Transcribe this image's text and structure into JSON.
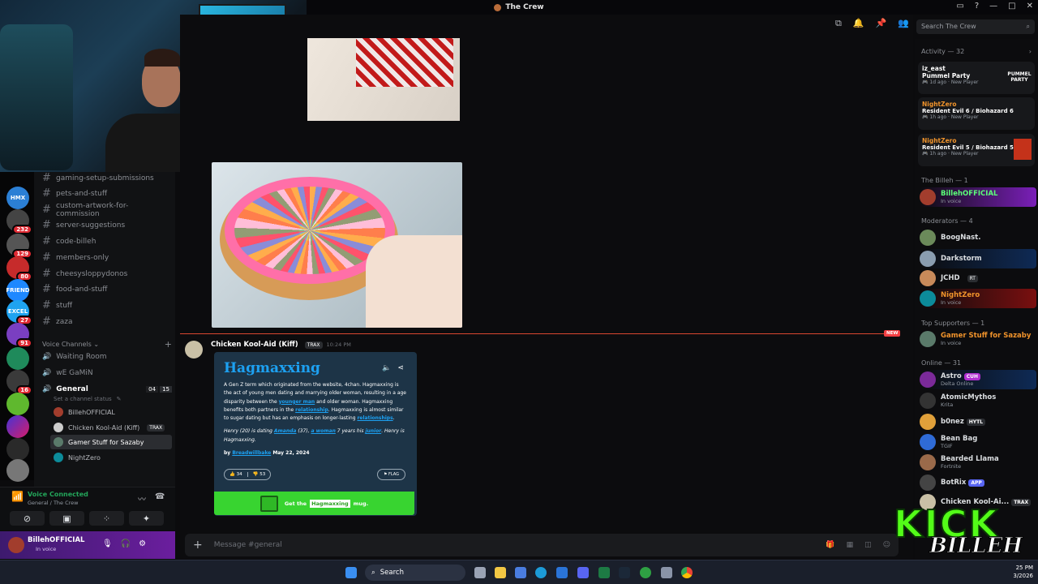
{
  "window": {
    "title": "The Crew",
    "icons": [
      "inbox-icon",
      "help-icon"
    ]
  },
  "channels": [
    {
      "name": "gaming-setup-submissions"
    },
    {
      "name": "pets-and-stuff"
    },
    {
      "name": "custom-artwork-for-commission"
    },
    {
      "name": "server-suggestions"
    },
    {
      "name": "code-billeh"
    },
    {
      "name": "members-only"
    },
    {
      "name": "cheesysloppydonos"
    },
    {
      "name": "food-and-stuff"
    },
    {
      "name": "stuff"
    },
    {
      "name": "zaza"
    }
  ],
  "voice": {
    "header": "Voice Channels",
    "rooms": [
      {
        "name": "Waiting Room"
      },
      {
        "name": "wE GaMiN"
      }
    ],
    "general": {
      "name": "General",
      "count_a": "04",
      "count_b": "15",
      "status": "Set a channel status",
      "users": [
        {
          "name": "BillehOFFICIAL"
        },
        {
          "name": "Chicken Kool-Aid (Kiff)",
          "tag": "TRAX"
        },
        {
          "name": "Gamer Stuff for Sazaby"
        },
        {
          "name": "NightZero"
        }
      ]
    }
  },
  "servers": {
    "badges": [
      "232",
      "129",
      "80",
      "27",
      "91",
      "16"
    ],
    "labels": [
      "FRIEND",
      "EXCEL"
    ]
  },
  "voicebar": {
    "status": "Voice Connected",
    "where": "General / The Crew"
  },
  "user": {
    "name": "BillehOFFICIAL",
    "status": "In voice"
  },
  "search": {
    "placeholder": "Search The Crew"
  },
  "message": {
    "author": "Chicken Kool-Aid (Kiff)",
    "tag": "TRAX",
    "time": "10:24 PM",
    "new_label": "NEW"
  },
  "card": {
    "title": "Hagmaxxing",
    "p1a": "A Gen Z term which originated from the website, 4chan. Hagmaxxing is the act of young men dating and marrying older woman, resulting in a age disparity between the ",
    "l1": "younger man",
    "p1b": " and older woman. Hagmaxxing benefits both partners in the ",
    "l2": "relationship",
    "p1c": ". Hagmaxxing is almost similar to sugar dating but has an emphasis on longer-lasting ",
    "l3": "relationships",
    "p1d": ".",
    "ex_a": "Henry (20) is dating ",
    "ex_l1": "Amanda",
    "ex_b": " (37), ",
    "ex_l2": "a woman",
    "ex_c": " 7 years his ",
    "ex_l3": "junior",
    "ex_d": ". Henry is Hagmaxxing.",
    "by": "by",
    "author": "Breadwillbake",
    "date": "May 22, 2024",
    "up": "34",
    "down": "53",
    "flag": "FLAG",
    "mug_a": "Get the",
    "mug_word": "Hagmaxxing",
    "mug_b": "mug."
  },
  "composer": {
    "placeholder": "Message #general"
  },
  "members": {
    "activity_header": "Activity — 32",
    "activities": [
      {
        "user": "iz_east",
        "game": "Pummel Party",
        "meta": "1d ago",
        "meta2": "New Player",
        "thumb": "PUMMEL PARTY"
      },
      {
        "user": "NightZero",
        "game": "Resident Evil 6 / Biohazard 6",
        "meta": "1h ago",
        "meta2": "New Player"
      },
      {
        "user": "NightZero",
        "game": "Resident Evil 5 / Biohazard 5",
        "meta": "1h ago",
        "meta2": "New Player"
      }
    ],
    "billeh_header": "The Billeh — 1",
    "billeh": {
      "name": "BillehOFFICIAL",
      "sub": "In voice"
    },
    "mods_header": "Moderators — 4",
    "mods": [
      {
        "name": "BoogNast.",
        "sub": "",
        "color": "#dbdee1"
      },
      {
        "name": "Darkstorm",
        "sub": "",
        "color": "#dbdee1"
      },
      {
        "name": "JCHD",
        "sub": "",
        "tag": "RT",
        "color": "#dbdee1"
      },
      {
        "name": "NightZero",
        "sub": "In voice",
        "color": "#f0932b"
      }
    ],
    "top_header": "Top Supporters — 1",
    "top": {
      "name": "Gamer Stuff for Sazaby",
      "sub": "In voice"
    },
    "online_header": "Online — 31",
    "online": [
      {
        "name": "Astro",
        "tag": "CUH",
        "sub": "Delta Online"
      },
      {
        "name": "AtomicMythos",
        "sub": "Krita"
      },
      {
        "name": "b0nez",
        "tag": "HYTL",
        "sub": ""
      },
      {
        "name": "Bean Bag",
        "sub": "TGIF"
      },
      {
        "name": "Bearded Llama",
        "sub": "Fortnite"
      },
      {
        "name": "BotRix",
        "tag": "APP",
        "sub": ""
      },
      {
        "name": "Chicken Kool-Ai...",
        "tag": "TRAX",
        "sub": ""
      }
    ]
  },
  "taskbar": {
    "search": "Search",
    "time": "25 PM",
    "date": "3/2026"
  },
  "overlay": {
    "kick": "KICK",
    "billeh": "BILLEH"
  }
}
